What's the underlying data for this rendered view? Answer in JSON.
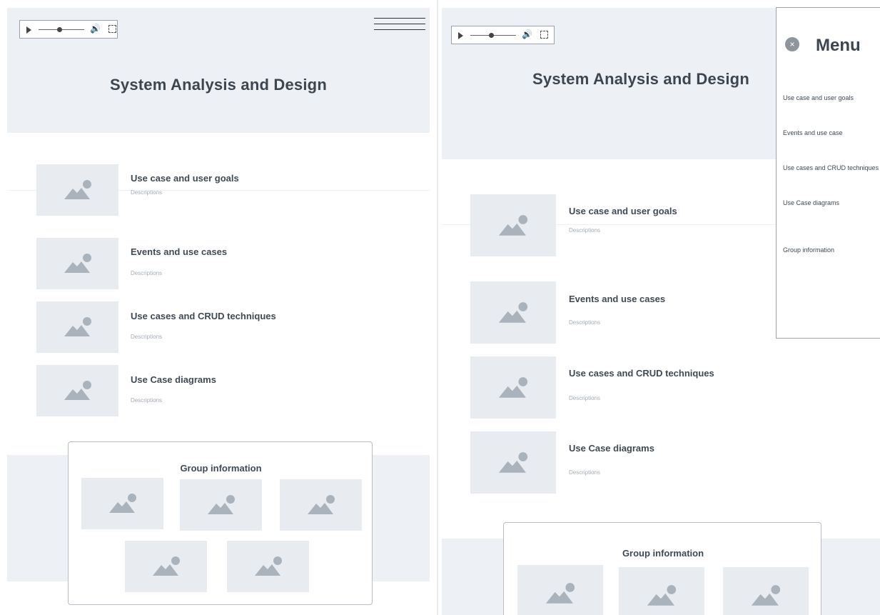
{
  "left": {
    "title": "System Analysis and Design",
    "items": [
      {
        "title": "Use case and user goals",
        "desc": "Descriptions"
      },
      {
        "title": "Events and use cases",
        "desc": "Descriptions"
      },
      {
        "title": "Use cases and CRUD techniques",
        "desc": "Descriptions"
      },
      {
        "title": "Use Case diagrams",
        "desc": "Descriptions"
      }
    ],
    "group_title": "Group information"
  },
  "right": {
    "title": "System Analysis and Design",
    "items": [
      {
        "title": "Use case and user goals",
        "desc": "Descriptions"
      },
      {
        "title": "Events and use cases",
        "desc": "Descriptions"
      },
      {
        "title": "Use cases and CRUD techniques",
        "desc": "Descriptions"
      },
      {
        "title": "Use Case diagrams",
        "desc": "Descriptions"
      }
    ],
    "group_title": "Group information"
  },
  "menu": {
    "title": "Menu",
    "close_icon": "×",
    "items": [
      "Use case and user goals",
      "Events and use case",
      "Use cases and CRUD techniques",
      "Use Case diagrams",
      "Group information"
    ]
  },
  "player": {
    "volume_icon": "🔊"
  },
  "colors": {
    "hero_bg": "#edf0f4",
    "thumb_bg": "#e8ecf1",
    "text": "#3f4a55",
    "muted": "#a4acb6"
  }
}
